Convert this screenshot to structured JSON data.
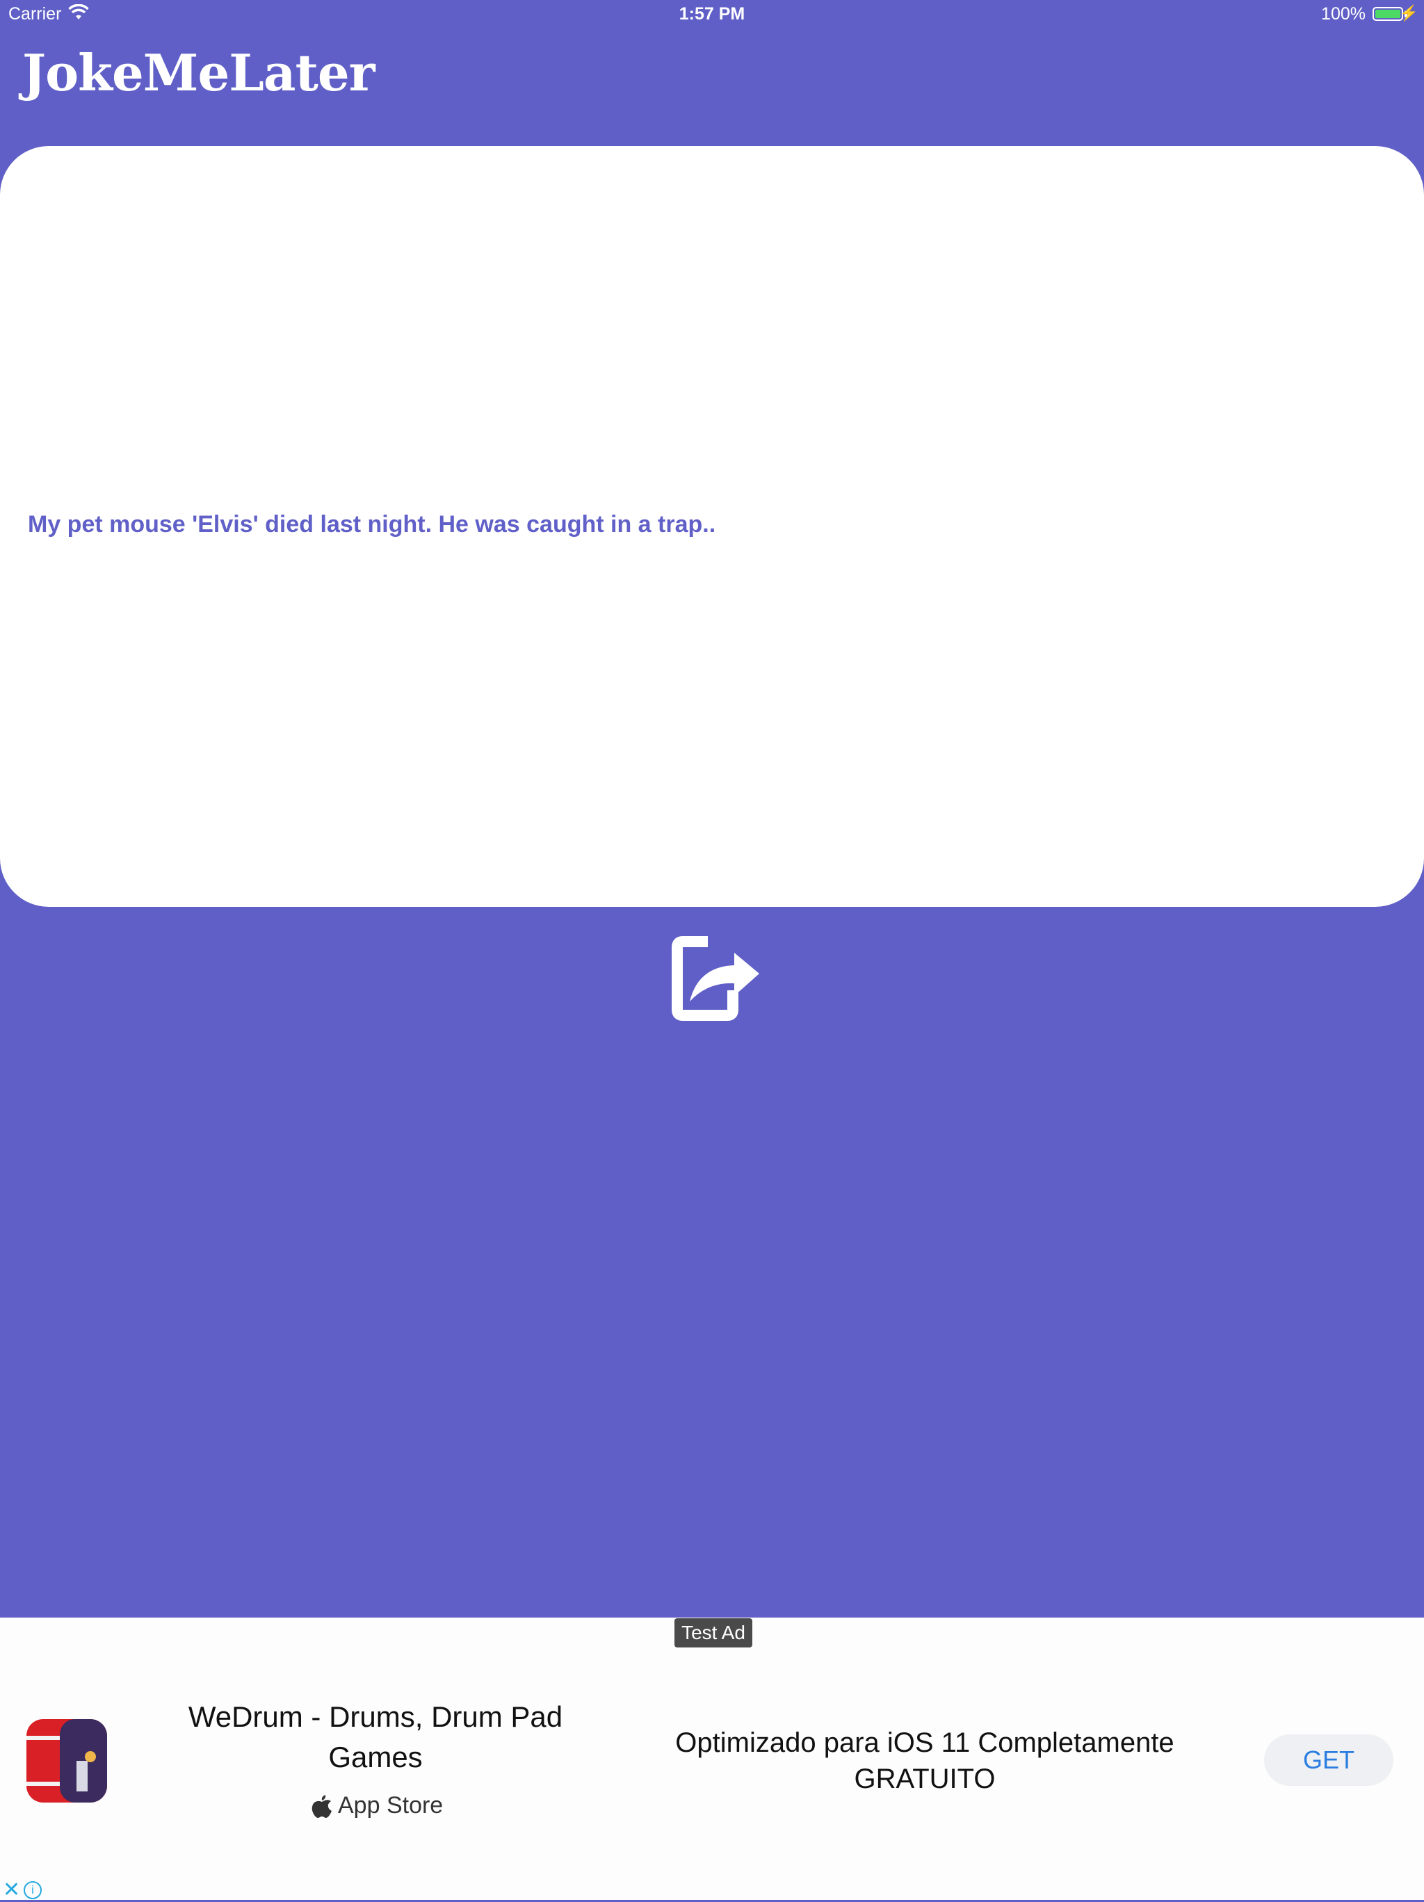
{
  "status_bar": {
    "carrier": "Carrier",
    "time": "1:57 PM",
    "battery": "100%",
    "wifi_icon": "wifi-icon",
    "battery_icon": "battery-icon"
  },
  "header": {
    "title": "JokeMeLater"
  },
  "joke": {
    "text": "My pet mouse 'Elvis' died last night. He was caught in a trap.."
  },
  "share": {
    "icon": "share-icon"
  },
  "ad": {
    "badge": "Test Ad",
    "title": "WeDrum - Drums, Drum Pad Games",
    "store": "App Store",
    "description": "Optimizado para iOS 11 Completamente GRATUITO",
    "cta": "GET",
    "close_icon": "close-icon",
    "info_icon": "info-icon"
  },
  "colors": {
    "background": "#5f5fc7",
    "joke_text": "#6060c8",
    "cta_text": "#2b7de0"
  }
}
